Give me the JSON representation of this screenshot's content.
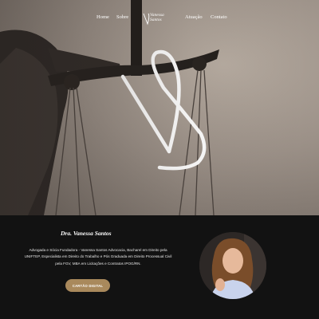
{
  "nav": {
    "links": [
      "Home",
      "Sobre",
      "Atuação",
      "Contato"
    ],
    "logo_text_line1": "Vanessa",
    "logo_text_line2": "Santos"
  },
  "profile": {
    "name": "Dra. Vanessa Santos",
    "bio": "Advogada e Sócia Fundadora - Vanessa Santos Advocacia, Bacharel em Direito pela UNIFTEP, Especialista em Direito do Trabalho e Pós Graduada em Direito Processual Civil pela FGV, MBA em Licitações e Contratos IPOG/RN.",
    "cta_label": "CARTÃO DIGITAL"
  },
  "colors": {
    "accent": "#a9895c",
    "dark_bg": "#121212"
  },
  "icons": {
    "logo": "vs-monogram-icon",
    "hero_image": "lady-justice-scales-image"
  }
}
